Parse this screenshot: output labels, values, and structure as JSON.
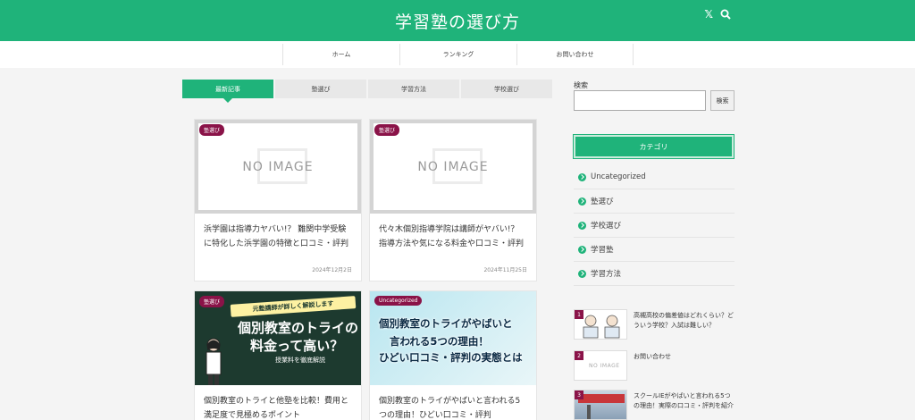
{
  "header": {
    "title": "学習塾の選び方",
    "x_icon": "x-logo-icon",
    "search_icon": "search-icon",
    "x_glyph": "𝕏",
    "accent": "#1fb37a"
  },
  "nav": {
    "items": [
      "ホーム",
      "ランキング",
      "お問い合わせ"
    ]
  },
  "tabs": [
    "最新記事",
    "塾選び",
    "学習方法",
    "学校選び"
  ],
  "cards": [
    {
      "badge": "塾選び",
      "image_text": "NO IMAGE",
      "title": "浜学園は指導力ヤバい!？ 難関中学受験に特化した浜学園の特徴と口コミ・評判",
      "date": "2024年12月2日"
    },
    {
      "badge": "塾選び",
      "image_text": "NO IMAGE",
      "title": "代々木個別指導学院は講師がヤバい!？ 指導方法や気になる料金や口コミ・評判",
      "date": "2024年11月25日"
    },
    {
      "badge": "塾選び",
      "image_lines": [
        "元塾講師が詳しく解説します",
        "個別教室のトライの",
        "料金って高い？",
        "授業料を徹底解説"
      ],
      "title": "個別教室のトライと他塾を比較！費用と満足度で見極めるポイント"
    },
    {
      "badge": "Uncategorized",
      "image_lines": [
        "個別教室のトライがやばいと",
        "言われる5つの理由！",
        "ひどい口コミ・評判の実態とは"
      ],
      "title": "個別教室のトライがやばいと言われる5つの理由！ひどい口コミ・評判"
    }
  ],
  "sidebar": {
    "search_label": "検索",
    "search_placeholder": "",
    "search_button": "検索",
    "category_heading": "カテゴリ",
    "categories": [
      "Uncategorized",
      "塾選び",
      "学校選び",
      "学習塾",
      "学習方法"
    ],
    "popular": [
      {
        "rank": "1",
        "title": "高槻高校の偏差値はどれくらい？どういう学校？入試は難しい？"
      },
      {
        "rank": "2",
        "title": "お問い合わせ",
        "image_text": "NO IMAGE"
      },
      {
        "rank": "3",
        "title": "スクールIEがやばいと言われる5つの理由！実際の口コミ・評判を紹介"
      }
    ]
  }
}
